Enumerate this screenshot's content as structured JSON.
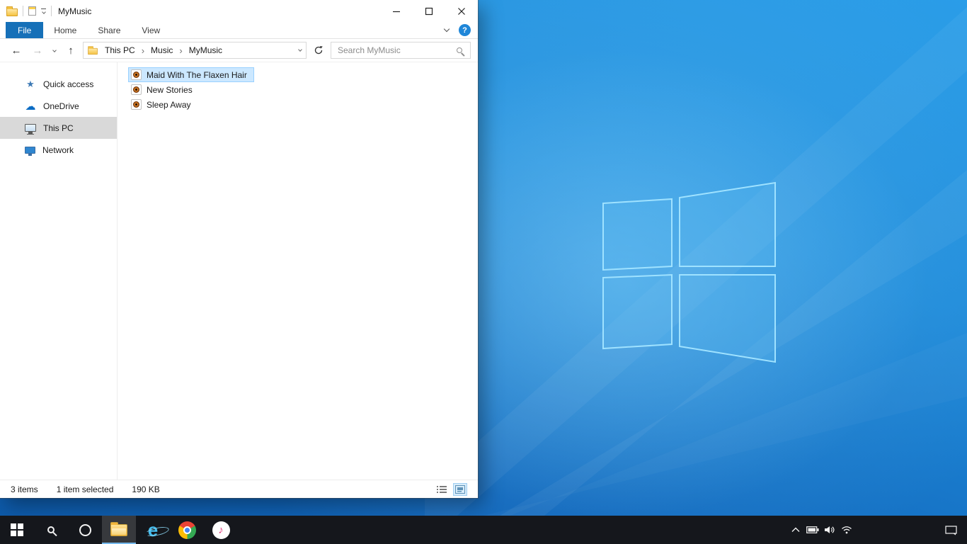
{
  "window": {
    "title": "MyMusic",
    "controls": [
      "minimize",
      "maximize",
      "close"
    ]
  },
  "ribbon": {
    "tabs": [
      "File",
      "Home",
      "Share",
      "View"
    ],
    "help_glyph": "?"
  },
  "glyphs": {
    "back": "←",
    "forward": "→",
    "up": "↑",
    "separator": "›"
  },
  "icon_glyphs": {
    "star": "★",
    "cloud": "☁"
  },
  "address": {
    "breadcrumb": [
      "This PC",
      "Music",
      "MyMusic"
    ],
    "search_placeholder": "Search MyMusic"
  },
  "sidebar": {
    "items": [
      {
        "label": "Quick access",
        "selected": false
      },
      {
        "label": "OneDrive",
        "selected": false
      },
      {
        "label": "This PC",
        "selected": true
      },
      {
        "label": "Network",
        "selected": false
      }
    ]
  },
  "files": {
    "items": [
      {
        "name": "Maid With The Flaxen Hair",
        "selected": true
      },
      {
        "name": "New Stories",
        "selected": false
      },
      {
        "name": "Sleep Away",
        "selected": false
      }
    ]
  },
  "status": {
    "items_count": "3 items",
    "selection": "1 item selected",
    "size": "190 KB"
  },
  "taskbar": {
    "buttons": [
      {
        "name": "start"
      },
      {
        "name": "search"
      },
      {
        "name": "cortana"
      },
      {
        "name": "file-explorer",
        "active": true
      },
      {
        "name": "internet-explorer",
        "glyph": "e"
      },
      {
        "name": "chrome"
      },
      {
        "name": "itunes",
        "glyph": "♪"
      }
    ]
  },
  "colors": {
    "file_tab": "#1670b8",
    "selection_bg": "#cce8ff",
    "selection_border": "#99d1ff",
    "taskbar_bg": "#15171c"
  }
}
